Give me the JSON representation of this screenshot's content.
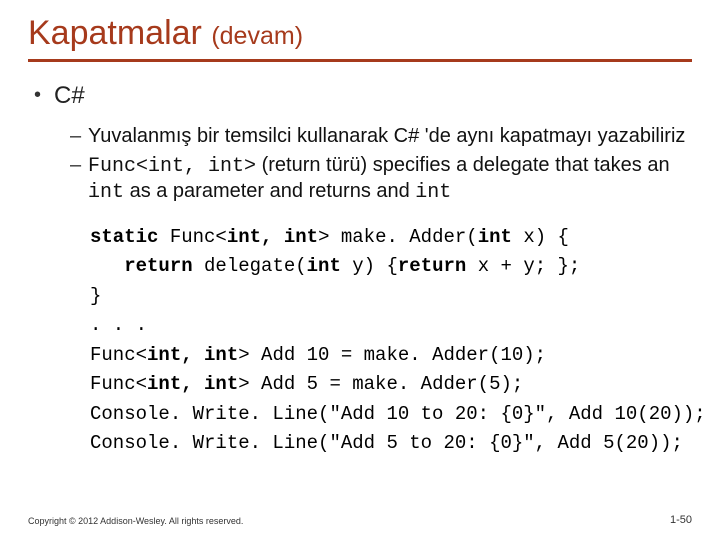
{
  "title_main": "Kapatmalar",
  "title_sub": "(devam)",
  "bullet1": "C#",
  "sub1": "Yuvalanmış bir temsilci kullanarak C# 'de aynı kapatmayı yazabiliriz",
  "sub2_pre": "",
  "sub2_code1": "Func<int, int>",
  "sub2_mid": " (return türü) specifies a delegate that takes an ",
  "sub2_code2": "int",
  "sub2_mid2": " as a parameter and returns and ",
  "sub2_code3": "int",
  "code": {
    "l1a": "static",
    "l1b": " Func<",
    "l1c": "int, int",
    "l1d": "> make. Adder(",
    "l1e": "int",
    "l1f": " x) {",
    "l2a": "   return",
    "l2b": " delegate(",
    "l2c": "int",
    "l2d": " y) {",
    "l2e": "return",
    "l2f": " x + y; };",
    "l3": "}",
    "l4": ". . .",
    "l5a": "Func<",
    "l5b": "int, int",
    "l5c": "> Add 10 = make. Adder(10);",
    "l6a": "Func<",
    "l6b": "int, int",
    "l6c": "> Add 5 = make. Adder(5);",
    "l7": "Console. Write. Line(\"Add 10 to 20: {0}\", Add 10(20));",
    "l8": "Console. Write. Line(\"Add 5 to 20: {0}\", Add 5(20));"
  },
  "footer": "Copyright © 2012 Addison-Wesley. All rights reserved.",
  "pagenum": "1-50"
}
